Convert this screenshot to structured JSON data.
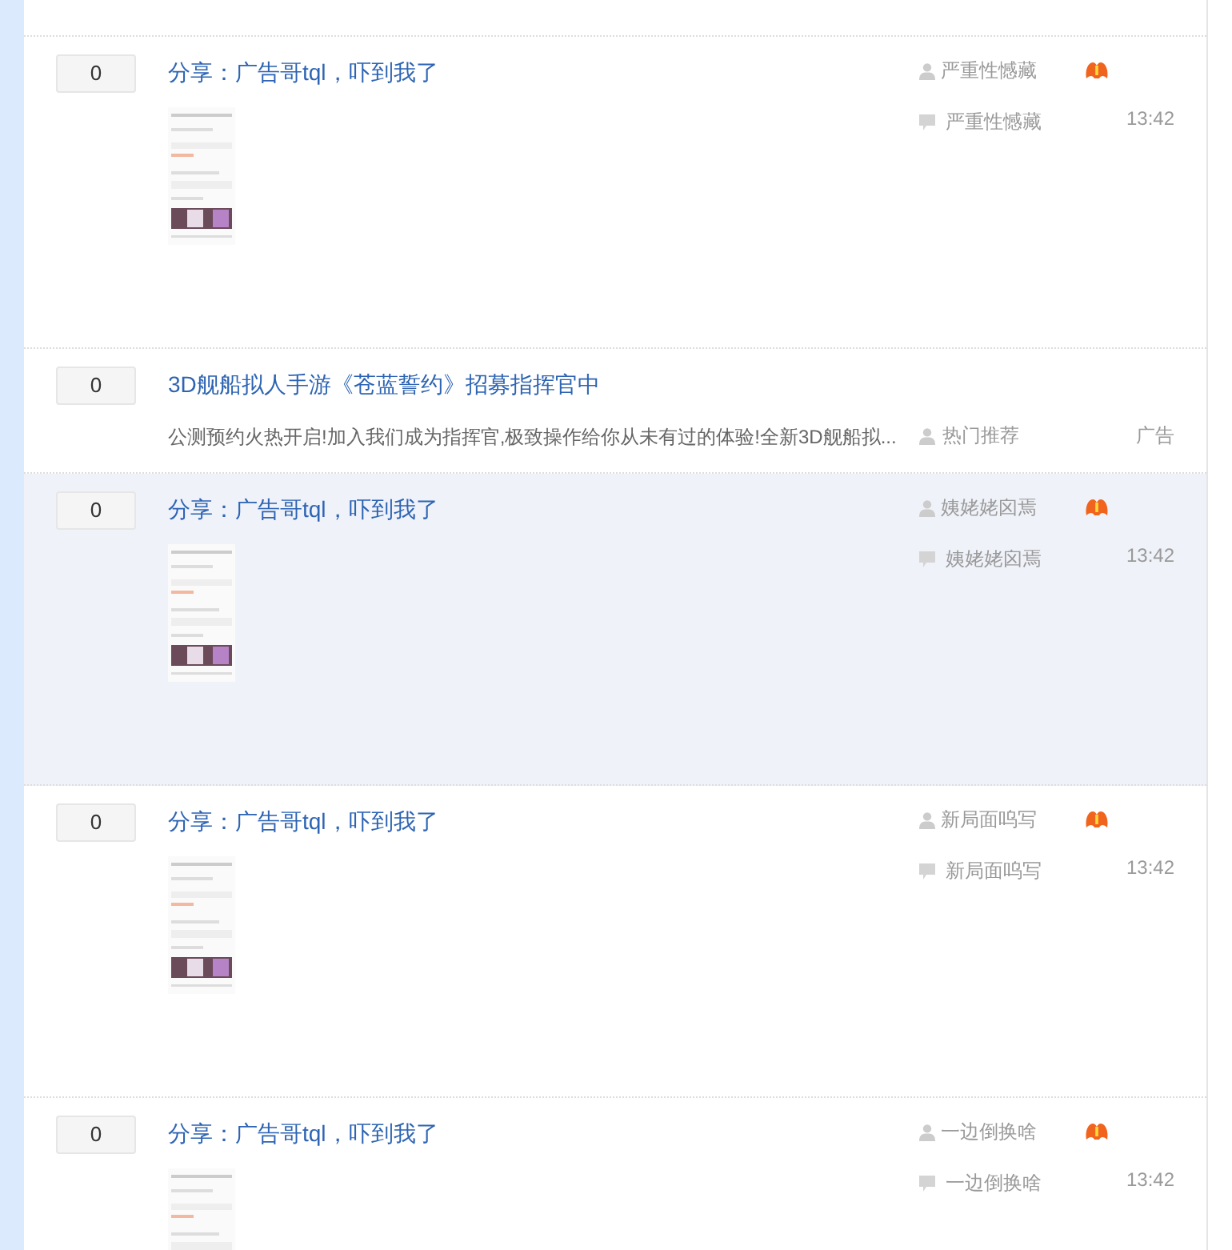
{
  "threads": [
    {
      "kind": "post",
      "selected": false,
      "reply_count": "0",
      "title": "分享：广告哥tql，吓到我了",
      "author": "严重性憾藏",
      "last_reply_by": "严重性憾藏",
      "time": "13:42"
    },
    {
      "kind": "ad",
      "selected": false,
      "reply_count": "0",
      "title": "3D舰船拟人手游《苍蓝誓约》招募指挥官中",
      "description": "公测预约火热开启!加入我们成为指挥官,极致操作给你从未有过的体验!全新3D舰船拟...",
      "author": "热门推荐",
      "ad_label": "广告"
    },
    {
      "kind": "post",
      "selected": true,
      "reply_count": "0",
      "title": "分享：广告哥tql，吓到我了",
      "author": "姨姥姥囟焉",
      "last_reply_by": "姨姥姥囟焉",
      "time": "13:42"
    },
    {
      "kind": "post",
      "selected": false,
      "reply_count": "0",
      "title": "分享：广告哥tql，吓到我了",
      "author": "新局面呜写",
      "last_reply_by": "新局面呜写",
      "time": "13:42"
    },
    {
      "kind": "post",
      "selected": false,
      "reply_count": "0",
      "title": "分享：广告哥tql，吓到我了",
      "author": "一边倒换啥",
      "last_reply_by": "一边倒换啥",
      "time": "13:42"
    }
  ]
}
